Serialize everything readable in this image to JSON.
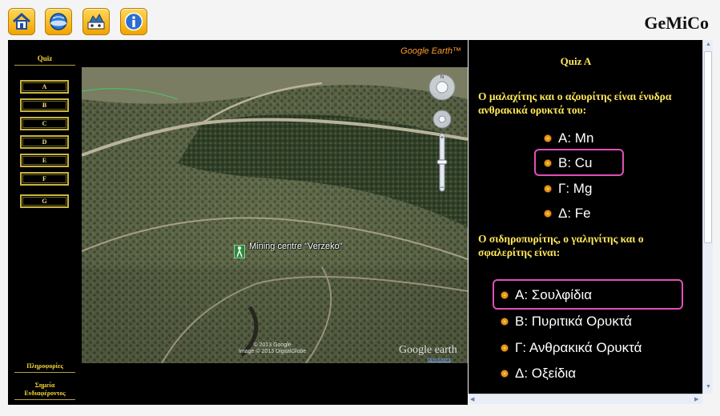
{
  "toolbar": {
    "buttons": [
      {
        "icon": "home-icon"
      },
      {
        "icon": "globe-icon"
      },
      {
        "icon": "map-icon"
      },
      {
        "icon": "info-icon"
      }
    ],
    "brand": "GeMiCo",
    "accent": "#f0a400"
  },
  "sidebar": {
    "heading": "Quiz",
    "quiz_buttons": [
      "A",
      "B",
      "C",
      "D",
      "E",
      "F",
      "G"
    ],
    "links": {
      "info": "Πληροφορίες",
      "points_line1": "Σημεία",
      "points_line2": "Ενδιαφέροντος"
    },
    "accent": "#f4d63a"
  },
  "map": {
    "provider_label": "Google Earth™",
    "placemark": "Mining centre \"Verzeko\"",
    "copyright_line1": "© 2013 Google",
    "copyright_line2": "Image © 2013 DigitalGlobe",
    "logo": "Google earth",
    "terms": "Όροι Χρήσης"
  },
  "quiz": {
    "title": "Quiz A",
    "questions": [
      {
        "text": "Ο μαλαχίτης και ο αζουρίτης είναι ένυδρα ανθρακικά ορυκτά του:",
        "options": [
          "A: Mn",
          "B: Cu",
          "Γ: Mg",
          "Δ: Fe"
        ],
        "selected": 1
      },
      {
        "text": "Ο σιδηροπυρίτης, ο γαληνίτης και ο σφαλερίτης είναι:",
        "options": [
          "A: Σουλφίδια",
          "B: Πυριτικά Ορυκτά",
          "Γ: Ανθρακικά Ορυκτά",
          "Δ: Οξείδια"
        ],
        "selected": 0
      }
    ],
    "highlight_color": "#e04fb8",
    "text_color": "#ffe65a"
  }
}
